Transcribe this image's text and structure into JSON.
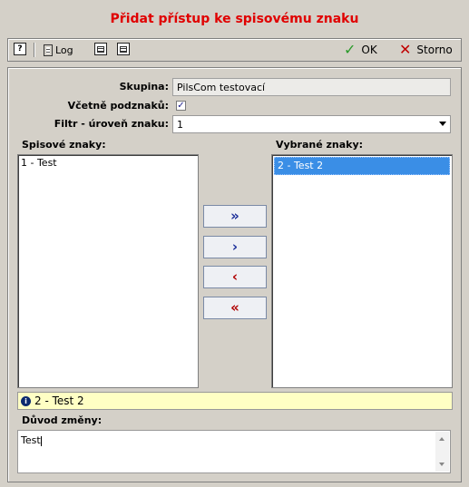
{
  "dialog": {
    "title": "Přidat přístup ke spisovému znaku"
  },
  "toolbar": {
    "help_glyph": "?",
    "log_label": "Log",
    "ok_label": "OK",
    "cancel_label": "Storno"
  },
  "form": {
    "group_label": "Skupina:",
    "group_value": "PilsCom testovací",
    "include_sub_label": "Včetně podznaků:",
    "include_sub_checked": true,
    "filter_label": "Filtr - úroveň znaku:",
    "filter_value": "1"
  },
  "lists": {
    "available_label": "Spisové znaky:",
    "available_items": [
      "1 - Test"
    ],
    "selected_label": "Vybrané znaky:",
    "selected_items": [
      "2 - Test 2"
    ]
  },
  "move_buttons": {
    "add_all": "»",
    "add": "›",
    "remove": "‹",
    "remove_all": "«"
  },
  "info": {
    "text": "2 - Test 2"
  },
  "reason": {
    "label": "Důvod změny:",
    "value": "Test"
  },
  "colors": {
    "title": "#e00000",
    "selection": "#3a8ee6",
    "info_bar": "#ffffc4",
    "background": "#d4d0c8"
  }
}
